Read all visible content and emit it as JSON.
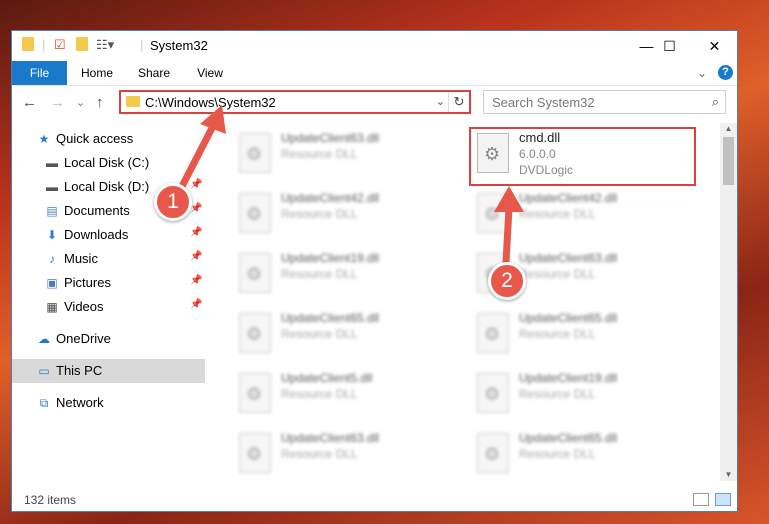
{
  "window": {
    "title": "System32",
    "controls": {
      "minimize": "—",
      "maximize": "☐",
      "close": "✕"
    }
  },
  "ribbon": {
    "tabs": [
      "File",
      "Home",
      "Share",
      "View"
    ],
    "expand": "⌄",
    "help": "?"
  },
  "navigation": {
    "back": "←",
    "forward": "→",
    "recent": "⌄",
    "up": "↑",
    "address": "C:\\Windows\\System32",
    "address_dropdown": "⌄",
    "refresh": "↻",
    "search_placeholder": "Search System32",
    "search_icon": "⌕"
  },
  "sidebar": {
    "items": [
      {
        "label": "Quick access",
        "icon": "star-icon",
        "glyph": "★",
        "color": "#2b79d6"
      },
      {
        "label": "Local Disk (C:)",
        "icon": "drive-icon",
        "glyph": "▬",
        "color": "#555555"
      },
      {
        "label": "Local Disk (D:)",
        "icon": "drive-icon",
        "glyph": "▬",
        "color": "#555555"
      },
      {
        "label": "Documents",
        "icon": "document-icon",
        "glyph": "▤",
        "color": "#4a7fb8"
      },
      {
        "label": "Downloads",
        "icon": "download-icon",
        "glyph": "⬇",
        "color": "#2b79d6"
      },
      {
        "label": "Music",
        "icon": "music-icon",
        "glyph": "♪",
        "color": "#2b79d6"
      },
      {
        "label": "Pictures",
        "icon": "pictures-icon",
        "glyph": "▣",
        "color": "#4a7fb8"
      },
      {
        "label": "Videos",
        "icon": "video-icon",
        "glyph": "▦",
        "color": "#444444"
      },
      {
        "label": "OneDrive",
        "icon": "cloud-icon",
        "glyph": "☁",
        "color": "#1979ca"
      },
      {
        "label": "This PC",
        "icon": "computer-icon",
        "glyph": "▭",
        "color": "#2b79d6"
      },
      {
        "label": "Network",
        "icon": "network-icon",
        "glyph": "⧉",
        "color": "#2b79d6"
      }
    ],
    "pin_glyph": "📌"
  },
  "files": {
    "left": [
      {
        "name": "UpdateClient63.dll",
        "type": "Resource DLL"
      },
      {
        "name": "UpdateClient42.dll",
        "type": "Resource DLL"
      },
      {
        "name": "UpdateClient19.dll",
        "type": "Resource DLL"
      },
      {
        "name": "UpdateClient65.dll",
        "type": "Resource DLL"
      },
      {
        "name": "UpdateClient5.dll",
        "type": "Resource DLL"
      },
      {
        "name": "UpdateClient63.dll",
        "type": "Resource DLL"
      }
    ],
    "right": [
      {
        "name": "cmd.dll",
        "type": "6.0.0.0",
        "extra": "DVDLogic"
      },
      {
        "name": "UpdateClient42.dll",
        "type": "Resource DLL"
      },
      {
        "name": "UpdateClient63.dll",
        "type": "Resource DLL"
      },
      {
        "name": "UpdateClient65.dll",
        "type": "Resource DLL"
      },
      {
        "name": "UpdateClient19.dll",
        "type": "Resource DLL"
      },
      {
        "name": "UpdateClient65.dll",
        "type": "Resource DLL"
      }
    ]
  },
  "status": {
    "items_count": "132 items"
  },
  "annotations": {
    "step1": "1",
    "step2": "2",
    "color": "#d94040"
  }
}
